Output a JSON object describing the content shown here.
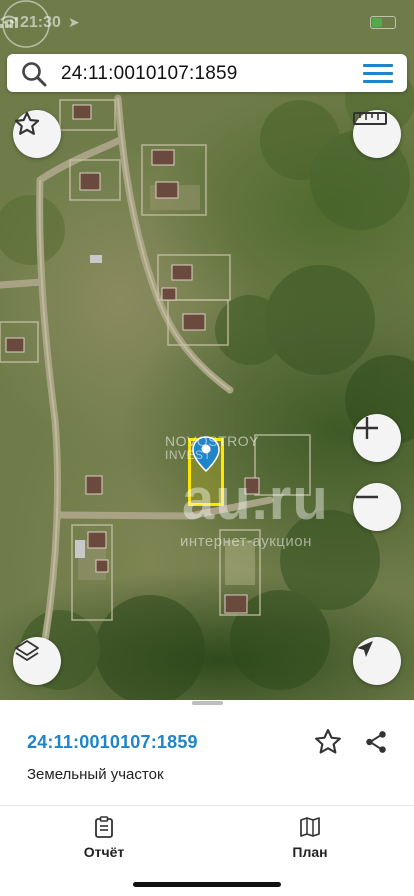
{
  "status_bar": {
    "time": "21:30"
  },
  "search": {
    "query": "24:11:0010107:1859"
  },
  "map": {
    "watermark": {
      "brand_line1": "NOVOSTROY",
      "brand_line2": "INVEST",
      "site": "au.ru",
      "site_sub": "интернет-аукцион"
    },
    "parcel_color": "#ffe600"
  },
  "icons": {
    "search": "magnifier-icon",
    "menu": "hamburger-menu-icon",
    "favorite_map": "star-icon",
    "ruler": "ruler-icon",
    "zoom_in": "plus-icon",
    "zoom_out": "minus-icon",
    "layers": "layers-icon",
    "locate": "navigation-arrow-icon",
    "pin": "location-pin-icon"
  },
  "details": {
    "cadastral_number": "24:11:0010107:1859",
    "type": "Земельный участок"
  },
  "tabs": [
    {
      "label": "Отчёт",
      "icon": "report-icon"
    },
    {
      "label": "План",
      "icon": "map-plan-icon"
    }
  ],
  "colors": {
    "accent": "#1f84c8",
    "battery": "#38d24a"
  }
}
